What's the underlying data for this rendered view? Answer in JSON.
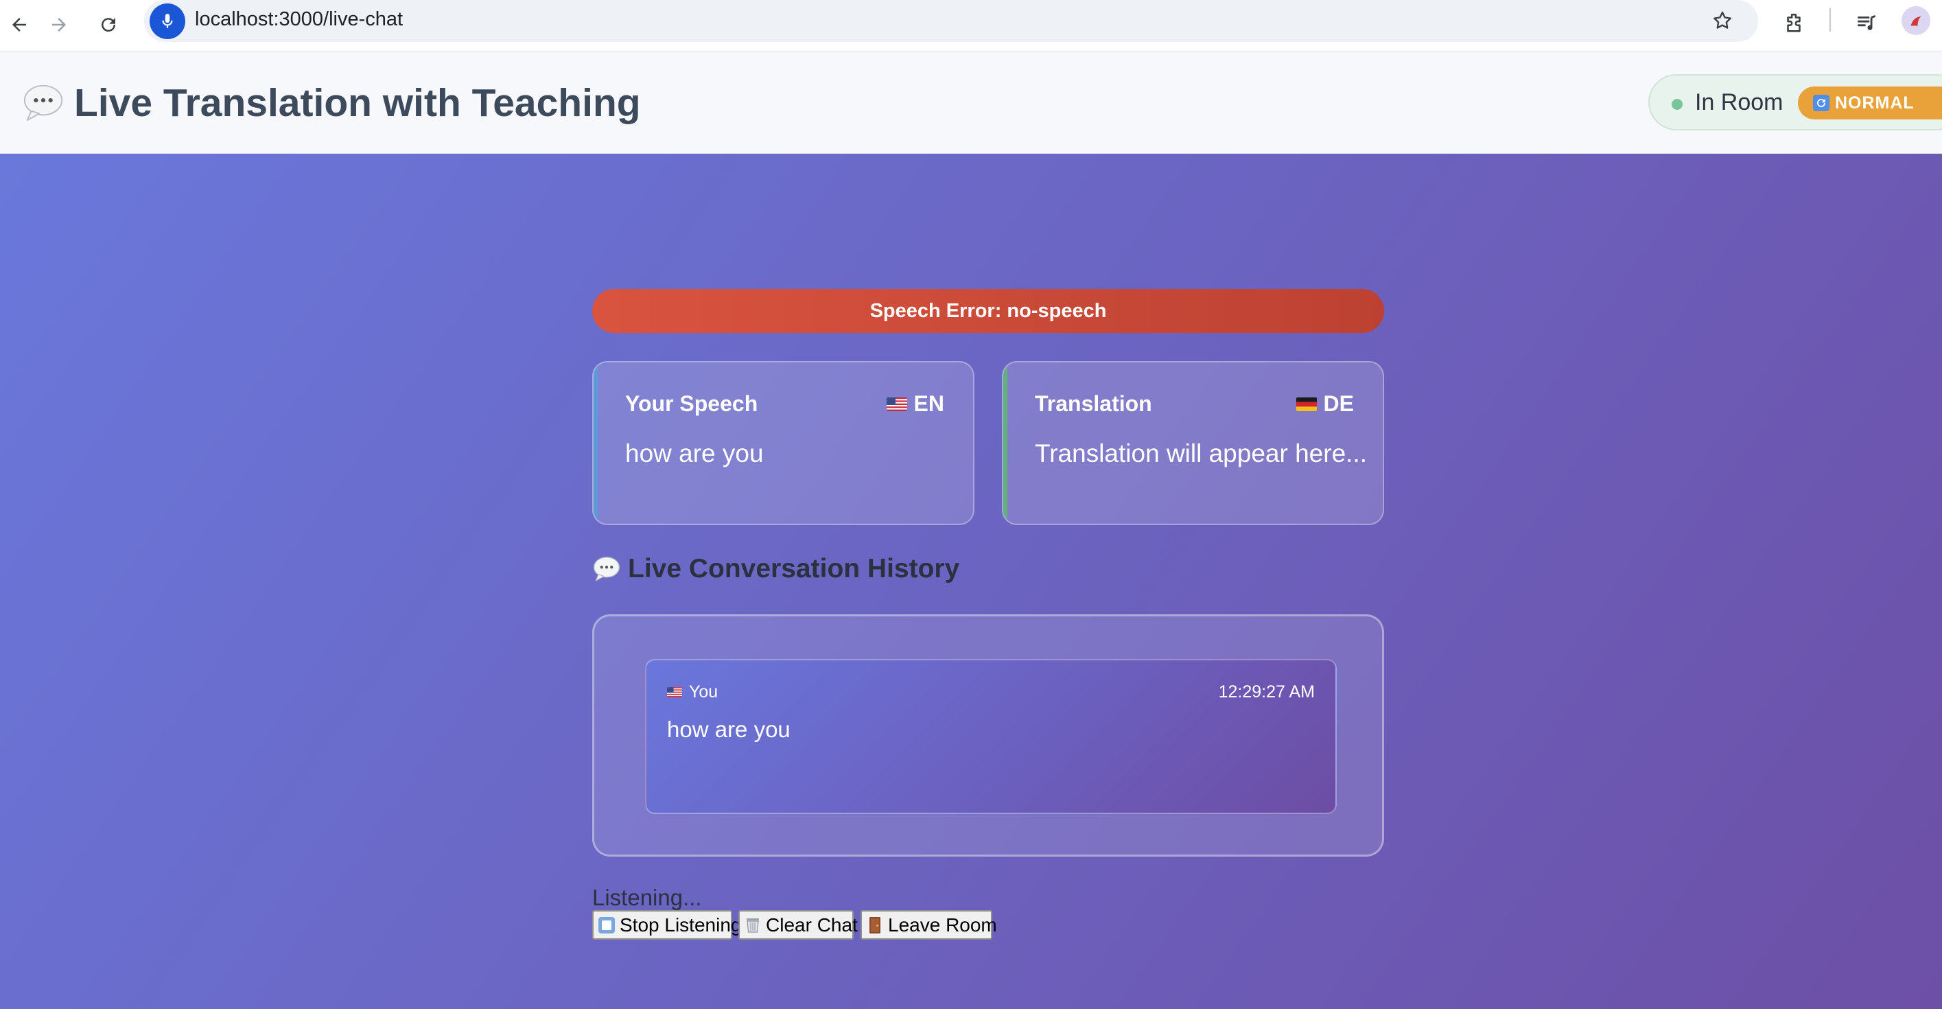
{
  "browser": {
    "url": "localhost:3000/live-chat",
    "icons": [
      "back-icon",
      "forward-icon",
      "reload-icon",
      "microphone-icon",
      "star-icon",
      "extensions-icon",
      "media-controls-icon",
      "profile-avatar"
    ]
  },
  "header": {
    "title": "Live Translation with Teaching",
    "title_icon": "speech-bubble-icon",
    "room_status": "In Room",
    "room_status_color": "#7bc498",
    "mode_badge": "NORMAL",
    "mode_badge_color": "#e9a23a"
  },
  "alerts": {
    "error": "Speech Error: no-speech",
    "error_color": "#cf4a37"
  },
  "speech_card": {
    "title": "Your Speech",
    "language_code": "EN",
    "language_flag": "us-flag",
    "text": "how are you",
    "accent_color": "#5a9bd8"
  },
  "translation_card": {
    "title": "Translation",
    "language_code": "DE",
    "language_flag": "de-flag",
    "text": "Translation will appear here...",
    "accent_color": "#5fb37a"
  },
  "history": {
    "title": "Live Conversation History",
    "messages": [
      {
        "author": "You",
        "flag": "us-flag",
        "time": "12:29:27 AM",
        "text": "how are you"
      }
    ]
  },
  "controls": {
    "status": "Listening...",
    "stop_label": "Stop Listening",
    "clear_label": "Clear Chat",
    "leave_label": "Leave Room"
  }
}
